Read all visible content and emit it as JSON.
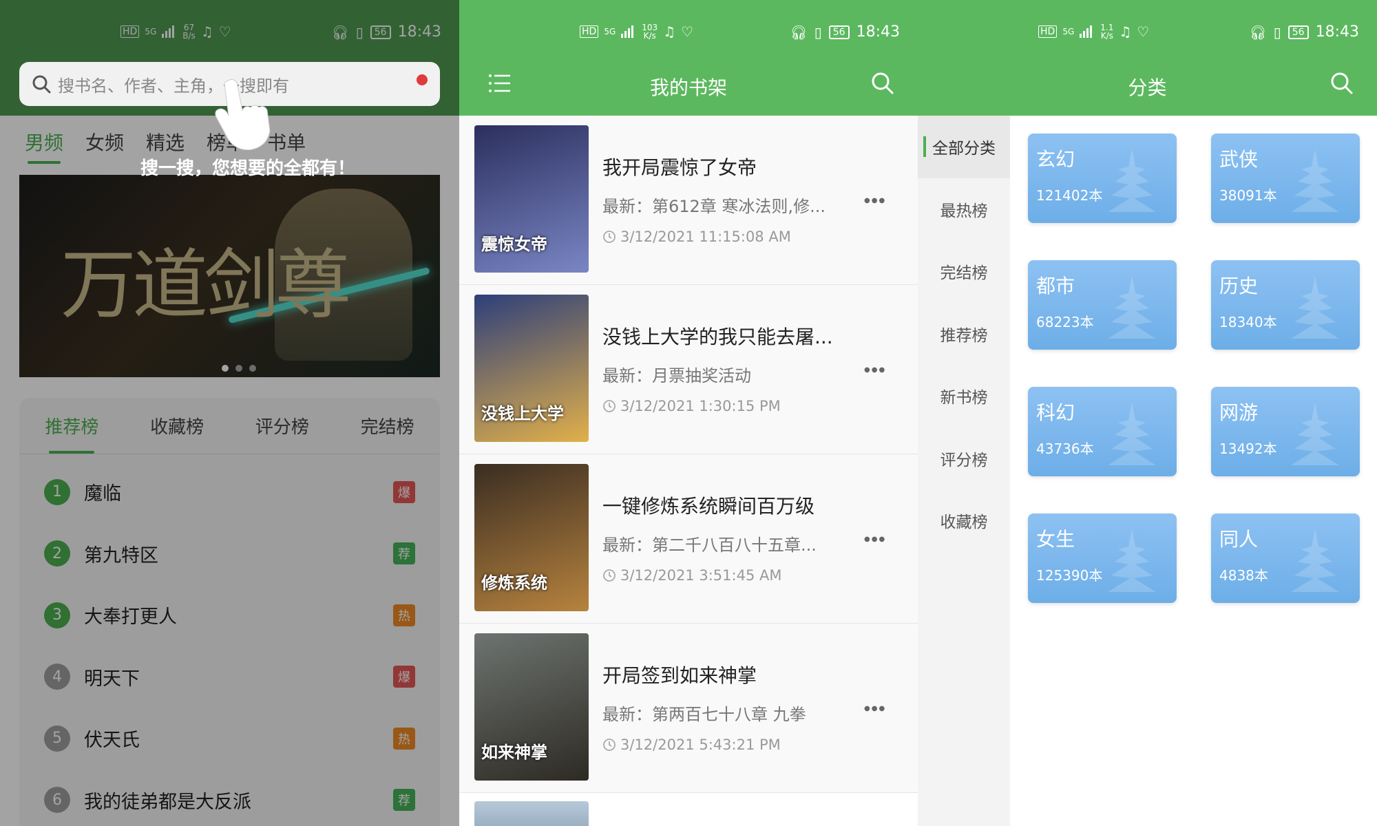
{
  "status": {
    "time": "18:43",
    "battery": "56",
    "p1_speed_top": "67",
    "p1_speed_unit": "B/s",
    "p2_speed_top": "103",
    "p2_speed_unit": "K/s",
    "p3_speed_top": "1.1",
    "p3_speed_unit": "K/s",
    "hd": "HD",
    "network": "5G"
  },
  "panel1": {
    "search_placeholder": "搜书名、作者、主角，一搜即有",
    "hint": "搜一搜，您想要的全都有！",
    "tabs": [
      {
        "label": "男频",
        "active": true
      },
      {
        "label": "女频"
      },
      {
        "label": "精选"
      },
      {
        "label": "榜单"
      },
      {
        "label": "书单"
      }
    ],
    "banner_text": "万道剑尊",
    "banner_dots": 3,
    "rank_tabs": [
      {
        "label": "推荐榜",
        "active": true
      },
      {
        "label": "收藏榜"
      },
      {
        "label": "评分榜"
      },
      {
        "label": "完结榜"
      }
    ],
    "rank_list": [
      {
        "num": "1",
        "title": "魔临",
        "badge": "爆",
        "num_color": "#4caf50",
        "badge_color": "#e35656"
      },
      {
        "num": "2",
        "title": "第九特区",
        "badge": "荐",
        "num_color": "#4caf50",
        "badge_color": "#45b35a"
      },
      {
        "num": "3",
        "title": "大奉打更人",
        "badge": "热",
        "num_color": "#4caf50",
        "badge_color": "#f08a24"
      },
      {
        "num": "4",
        "title": "明天下",
        "badge": "爆",
        "num_color": "#9e9e9e",
        "badge_color": "#e35656"
      },
      {
        "num": "5",
        "title": "伏天氏",
        "badge": "热",
        "num_color": "#9e9e9e",
        "badge_color": "#f08a24"
      },
      {
        "num": "6",
        "title": "我的徒弟都是大反派",
        "badge": "荐",
        "num_color": "#9e9e9e",
        "badge_color": "#45b35a"
      }
    ]
  },
  "panel2": {
    "title": "我的书架",
    "books": [
      {
        "title": "我开局震惊了女帝",
        "latest": "最新：第612章 寒冰法则,修...",
        "time": "3/12/2021 11:15:08 AM",
        "cover_text": "震惊女帝",
        "cover_colors": [
          "#2b2f5e",
          "#7a86c4"
        ]
      },
      {
        "title": "没钱上大学的我只能去屠...",
        "latest": "最新：月票抽奖活动",
        "time": "3/12/2021 1:30:15 PM",
        "cover_text": "没钱上大学",
        "cover_colors": [
          "#2d3f7a",
          "#e2b04a"
        ]
      },
      {
        "title": "一键修炼系统瞬间百万级",
        "latest": "最新：第二千八百八十五章...",
        "time": "3/12/2021 3:51:45 AM",
        "cover_text": "修炼系统",
        "cover_colors": [
          "#3a2d22",
          "#b7833e"
        ]
      },
      {
        "title": "开局签到如来神掌",
        "latest": "最新：第两百七十八章 九拳",
        "time": "3/12/2021 5:43:21 PM",
        "cover_text": "如来神掌",
        "cover_colors": [
          "#6d7470",
          "#2e2a24"
        ]
      }
    ]
  },
  "panel3": {
    "title": "分类",
    "side_items": [
      {
        "label": "全部分类",
        "active": true
      },
      {
        "label": "最热榜"
      },
      {
        "label": "完结榜"
      },
      {
        "label": "推荐榜"
      },
      {
        "label": "新书榜"
      },
      {
        "label": "评分榜"
      },
      {
        "label": "收藏榜"
      }
    ],
    "categories": [
      {
        "name": "玄幻",
        "count": "121402本"
      },
      {
        "name": "武侠",
        "count": "38091本"
      },
      {
        "name": "都市",
        "count": "68223本"
      },
      {
        "name": "历史",
        "count": "18340本"
      },
      {
        "name": "科幻",
        "count": "43736本"
      },
      {
        "name": "网游",
        "count": "13492本"
      },
      {
        "name": "女生",
        "count": "125390本"
      },
      {
        "name": "同人",
        "count": "4838本"
      }
    ]
  },
  "colors": {
    "primary_green": "#5cb85f",
    "active_green": "#4caf50",
    "card_blue": "#7bb8ee"
  },
  "icons": {
    "search": "search-icon",
    "menu": "menu-icon",
    "more": "more-icon",
    "clock": "clock-icon",
    "hand": "hand-pointer-icon"
  }
}
